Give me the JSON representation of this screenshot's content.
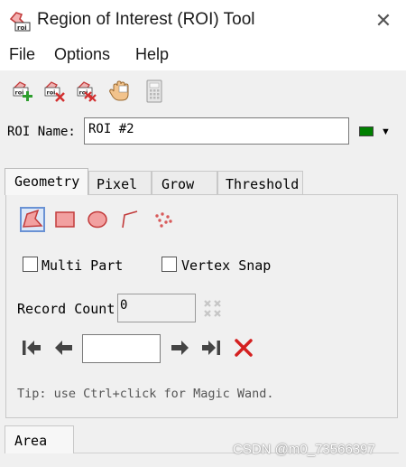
{
  "window": {
    "title": "Region of Interest (ROI) Tool",
    "close_glyph": "✕"
  },
  "menu": [
    {
      "label": "File"
    },
    {
      "label": "Options"
    },
    {
      "label": "Help"
    }
  ],
  "toolbar": {
    "icons": [
      "new-roi-icon",
      "delete-roi-icon",
      "delete-all-roi-icon",
      "hand-pan-icon",
      "calculator-icon"
    ]
  },
  "roi": {
    "name_label": "ROI Name:",
    "name_value": "ROI #2",
    "color": "#008000",
    "color_dropdown_glyph": "▼"
  },
  "tabs": [
    {
      "label": "Geometry",
      "active": true
    },
    {
      "label": "Pixel",
      "active": false
    },
    {
      "label": "Grow",
      "active": false
    },
    {
      "label": "Threshold",
      "active": false
    }
  ],
  "geometry": {
    "shape_tools": [
      "polygon-tool-icon",
      "rectangle-tool-icon",
      "ellipse-tool-icon",
      "polyline-tool-icon",
      "point-tool-icon"
    ],
    "selected_tool": "polygon-tool-icon",
    "multi_part": {
      "label": "Multi Part",
      "checked": false
    },
    "vertex_snap": {
      "label": "Vertex Snap",
      "checked": false
    },
    "record_count": {
      "label": "Record Count",
      "value": "0"
    },
    "record_input_value": "",
    "tip": "Tip: use Ctrl+click for Magic Wand."
  },
  "bottom_tabs": [
    {
      "label": "Area",
      "active": true
    }
  ],
  "watermark": "CSDN @m0_73566397"
}
